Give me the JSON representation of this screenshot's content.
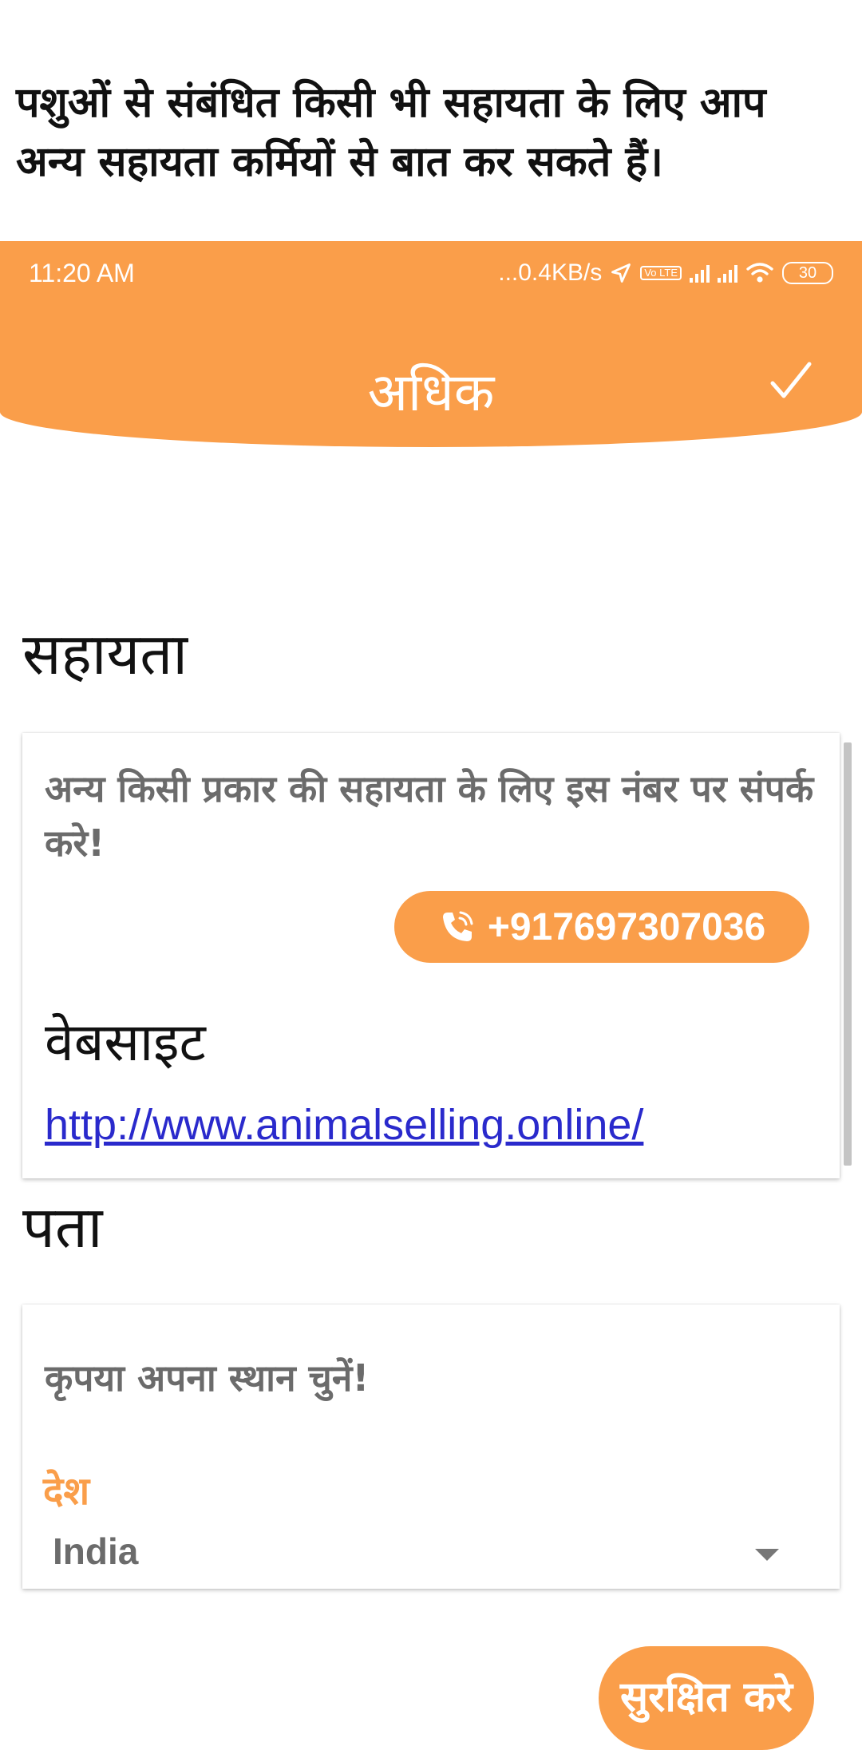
{
  "caption": "पशुओं से संबंधित किसी भी सहायता के लिए आप अन्य सहायता कर्मियों से बात कर सकते हैं।",
  "status_bar": {
    "time": "11:20 AM",
    "network_speed": "...0.4KB/s",
    "volte": "Vo LTE",
    "battery": "30"
  },
  "header": {
    "title": "अधिक",
    "confirm_icon": "checkmark-icon"
  },
  "support_section": {
    "title": "सहायता",
    "help_text": "अन्य किसी प्रकार की सहायता के लिए इस नंबर पर संपर्क करे!",
    "phone": "+917697307036",
    "website_title": "वेबसाइट",
    "website_url": "http://www.animalselling.online/"
  },
  "address_section": {
    "title": "पता",
    "prompt": "कृपया अपना स्थान चुनें!",
    "country_label": "देश",
    "country_value": "India"
  },
  "save_button": "सुरक्षित करे",
  "colors": {
    "accent": "#fa9e4a",
    "link": "#2a2acc",
    "muted_text": "#6b6b6b"
  }
}
